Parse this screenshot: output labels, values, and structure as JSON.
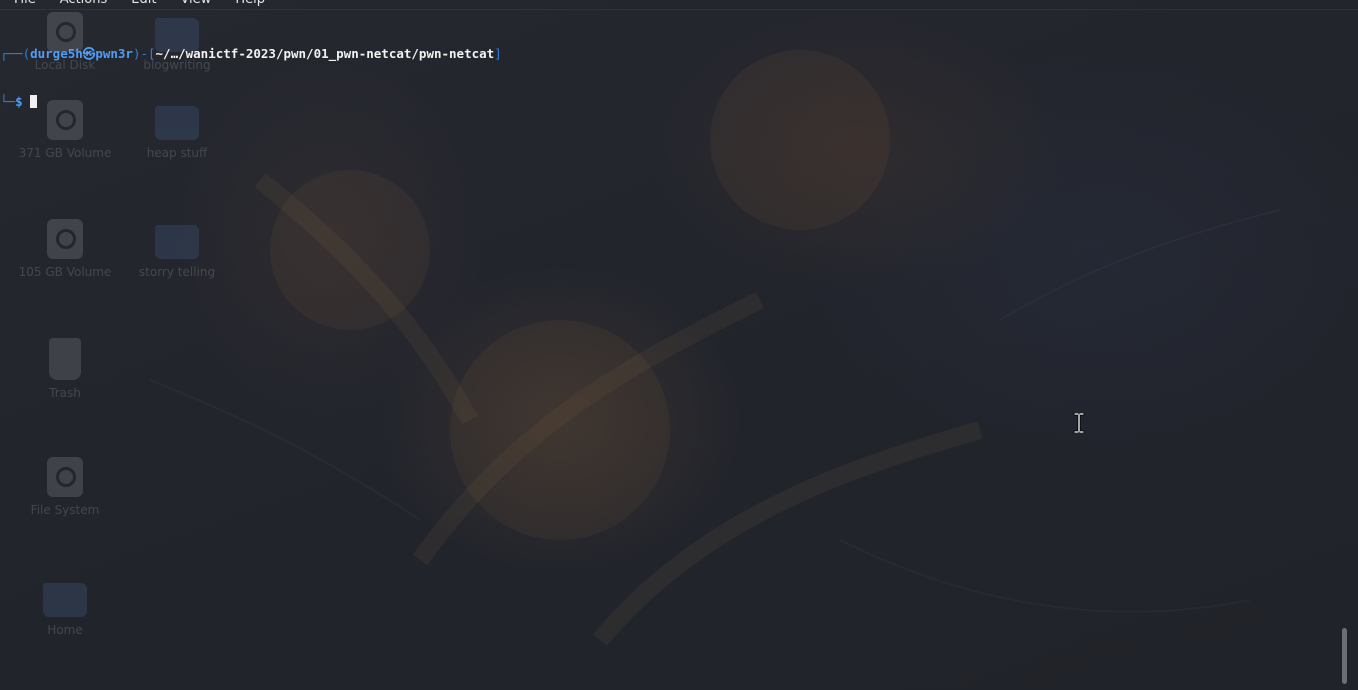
{
  "terminal": {
    "menu": [
      "File",
      "Actions",
      "Edit",
      "View",
      "Help"
    ],
    "prompt": {
      "frame_top": "┌──(",
      "user": "durge5h",
      "at_symbol": "㉿",
      "host": "pwn3r",
      "path_sep": ")-[",
      "path": "~/…/wanictf-2023/pwn/01_pwn-netcat/pwn-netcat",
      "path_close": "]",
      "frame_bottom": "└─",
      "dollar": "$"
    }
  },
  "desktop": {
    "icons": [
      {
        "label": "Local Disk",
        "kind": "drive"
      },
      {
        "label": "blogwriting",
        "kind": "folder"
      },
      {
        "label": "371 GB Volume",
        "kind": "drive"
      },
      {
        "label": "heap stuff",
        "kind": "folder"
      },
      {
        "label": "105 GB Volume",
        "kind": "drive"
      },
      {
        "label": "storry telling",
        "kind": "folder"
      },
      {
        "label": "Trash",
        "kind": "trash"
      },
      {
        "label": "File System",
        "kind": "drive"
      },
      {
        "label": "Home",
        "kind": "home"
      }
    ]
  },
  "colors": {
    "background": "#22242c",
    "prompt_blue": "#2f7fd8",
    "user_blue": "#4f9ef8",
    "path_white": "#f2f2f2"
  },
  "icons": {
    "mouse_cursor": "i-beam-cursor-icon"
  }
}
